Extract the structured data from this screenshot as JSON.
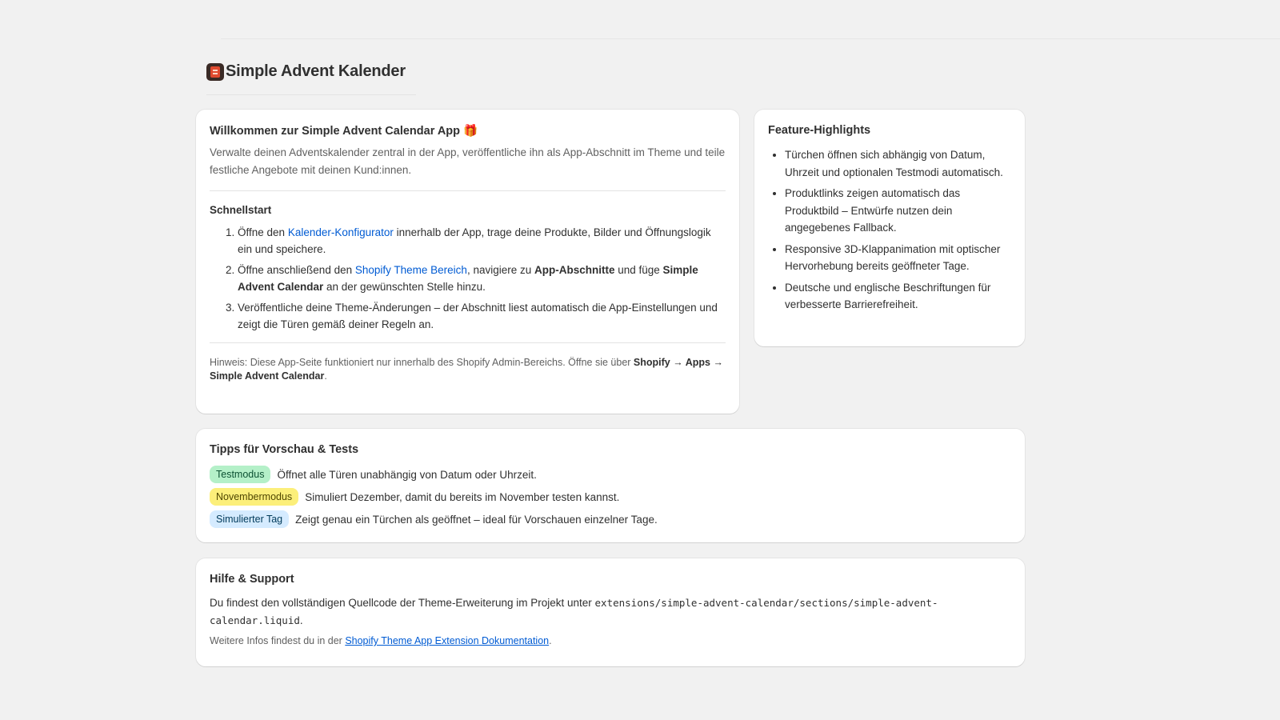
{
  "header": {
    "app_icon": "advent-calendar-icon",
    "title": "Simple Advent Kalender"
  },
  "welcome": {
    "title": "Willkommen zur Simple Advent Calendar App",
    "title_emoji": "🎁",
    "subtitle": "Verwalte deinen Adventskalender zentral in der App, veröffentliche ihn als App-Abschnitt im Theme und teile festliche Angebote mit deinen Kund:innen.",
    "quickstart_title": "Schnellstart",
    "steps": {
      "s1_pre": "Öffne den ",
      "s1_link": "Kalender-Konfigurator",
      "s1_post": " innerhalb der App, trage deine Produkte, Bilder und Öffnungslogik ein und speichere.",
      "s2_pre": "Öffne anschließend den ",
      "s2_link": "Shopify Theme Bereich",
      "s2_mid": ", navigiere zu ",
      "s2_bold1": "App-Abschnitte",
      "s2_mid2": " und füge ",
      "s2_bold2": "Simple Advent Calendar",
      "s2_post": " an der gewünschten Stelle hinzu.",
      "s3": "Veröffentliche deine Theme-Änderungen – der Abschnitt liest automatisch die App-Einstellungen und zeigt die Türen gemäß deiner Regeln an."
    },
    "note_pre": "Hinweis: Diese App-Seite funktioniert nur innerhalb des Shopify Admin-Bereichs. Öffne sie über ",
    "note_bold": "Shopify → Apps → Simple Advent Calendar",
    "note_post": "."
  },
  "features": {
    "title": "Feature-Highlights",
    "items": [
      "Türchen öffnen sich abhängig von Datum, Uhrzeit und optionalen Testmodi automatisch.",
      "Produktlinks zeigen automatisch das Produktbild – Entwürfe nutzen dein angegebenes Fallback.",
      "Responsive 3D-Klappanimation mit optischer Hervorhebung bereits geöffneter Tage.",
      "Deutsche und englische Beschriftungen für verbesserte Barrierefreiheit."
    ]
  },
  "tips": {
    "title": "Tipps für Vorschau & Tests",
    "rows": [
      {
        "badge": "Testmodus",
        "text": "Öffnet alle Türen unabhängig von Datum oder Uhrzeit."
      },
      {
        "badge": "Novembermodus",
        "text": "Simuliert Dezember, damit du bereits im November testen kannst."
      },
      {
        "badge": "Simulierter Tag",
        "text": "Zeigt genau ein Türchen als geöffnet – ideal für Vorschauen einzelner Tage."
      }
    ]
  },
  "help": {
    "title": "Hilfe & Support",
    "text_pre": "Du findest den vollständigen Quellcode der Theme-Erweiterung im Projekt unter ",
    "code_path": "extensions/simple-advent-calendar/sections/simple-advent-calendar.liquid",
    "text_post": ".",
    "more_pre": "Weitere Infos findest du in der ",
    "more_link": "Shopify Theme App Extension Dokumentation",
    "more_post": "."
  },
  "colors": {
    "link": "#005bd3",
    "badge_green": "#b4f0c8",
    "badge_yellow": "#fcef7a",
    "badge_blue": "#d5ebff"
  }
}
